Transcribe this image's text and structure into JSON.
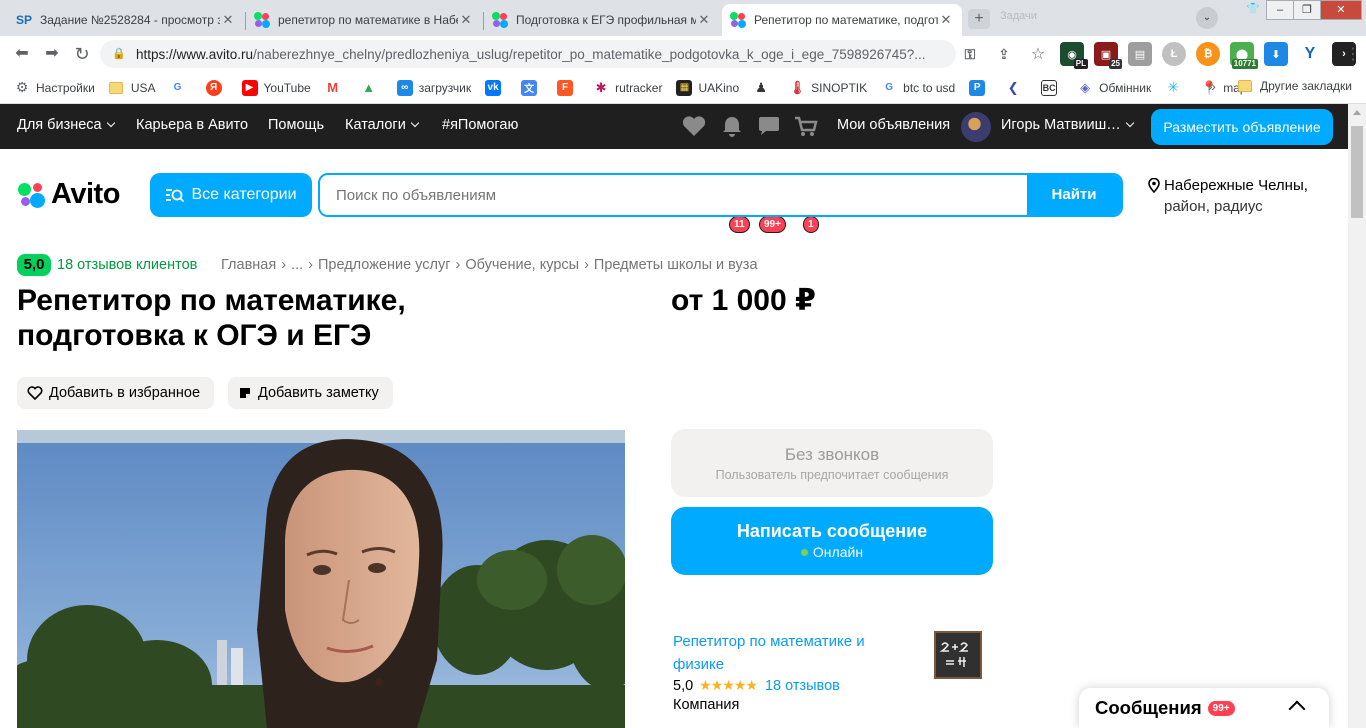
{
  "browser": {
    "tabs": [
      {
        "favicon": "SP",
        "title": "Задание №2528284 - просмотр за"
      },
      {
        "favicon": "avito-icon",
        "title": "репетитор по математике в Набе"
      },
      {
        "favicon": "avito-icon",
        "title": "Подготовка к ЕГЭ профильная ма"
      },
      {
        "favicon": "avito-icon",
        "title": "Репетитор по математике, подгот"
      }
    ],
    "ghost_tab": "Задачи",
    "url_host": "https://www.avito.ru",
    "url_path": "/naberezhnye_chelny/predlozheniya_uslug/repetitor_po_matematike_podgotovka_k_oge_i_ege_7598926745?...",
    "extensions": [
      {
        "name": "pl-extension-icon",
        "badge": "PL"
      },
      {
        "name": "counter-extension-icon",
        "badge": "25"
      },
      {
        "name": "gift-extension-icon",
        "badge": ""
      },
      {
        "name": "coin-extension-icon",
        "badge": ""
      },
      {
        "name": "bitcoin-extension-icon",
        "badge": ""
      },
      {
        "name": "price-extension-icon",
        "badge": "10771"
      },
      {
        "name": "download-extension-icon",
        "badge": ""
      },
      {
        "name": "v-extension-icon",
        "badge": ""
      },
      {
        "name": "terminal-extension-icon",
        "badge": ""
      },
      {
        "name": "puzzle-extension-icon",
        "badge": ""
      }
    ],
    "profile_initial": "I",
    "bookmarks": [
      {
        "icon": "gear-icon",
        "label": "Настройки"
      },
      {
        "icon": "folder-icon",
        "label": "USA"
      },
      {
        "icon": "google-icon",
        "label": ""
      },
      {
        "icon": "yandex-icon",
        "label": ""
      },
      {
        "icon": "youtube-icon",
        "label": "YouTube"
      },
      {
        "icon": "gmail-icon",
        "label": ""
      },
      {
        "icon": "drive-icon",
        "label": ""
      },
      {
        "icon": "infinity-icon",
        "label": "загрузчик"
      },
      {
        "icon": "vk-icon",
        "label": ""
      },
      {
        "icon": "translate-icon",
        "label": ""
      },
      {
        "icon": "f-icon",
        "label": ""
      },
      {
        "icon": "rutracker-icon",
        "label": "rutracker"
      },
      {
        "icon": "uakino-icon",
        "label": "UAKino"
      },
      {
        "icon": "chess-icon",
        "label": ""
      },
      {
        "icon": "thermometer-icon",
        "label": "SINOPTIK"
      },
      {
        "icon": "google-icon",
        "label": "btc to usd"
      },
      {
        "icon": "p-icon",
        "label": ""
      },
      {
        "icon": "arrow-icon",
        "label": ""
      },
      {
        "icon": "bc-icon",
        "label": ""
      },
      {
        "icon": "diamond-icon",
        "label": "Обмінник"
      },
      {
        "icon": "snowflake-icon",
        "label": ""
      },
      {
        "icon": "maps-icon",
        "label": "maps"
      }
    ],
    "other_bookmarks": "Другие закладки"
  },
  "nav": {
    "business": "Для бизнеса",
    "career": "Карьера в Авито",
    "help": "Помощь",
    "catalogs": "Каталоги",
    "i_help": "#яПомогаю",
    "notifications_badge": "11",
    "messages_badge": "99+",
    "cart_badge": "1",
    "my_ads": "Мои объявления",
    "user": "Игорь Матвииш…",
    "post_ad": "Разместить объявление"
  },
  "header": {
    "logo": "Avito",
    "categories": "Все категории",
    "search_placeholder": "Поиск по объявлениям",
    "search_button": "Найти",
    "location_city": "Набережные Челны,",
    "location_area": "район, радиус"
  },
  "listing": {
    "rating": "5,0",
    "reviews": "18 отзывов клиентов",
    "breadcrumbs": [
      "Главная",
      "›",
      "...",
      "›",
      "Предложение услуг",
      "›",
      "Обучение, курсы",
      "›",
      "Предметы школы и вуза"
    ],
    "title": "Репетитор по математике, подготовка к ОГЭ и ЕГЭ",
    "price": "от 1 000 ₽",
    "add_favorite": "Добавить в избранное",
    "add_note": "Добавить заметку"
  },
  "contact": {
    "no_calls": "Без звонков",
    "no_calls_hint": "Пользователь предпочитает сообщения",
    "write_message": "Написать сообщение",
    "online": "Онлайн"
  },
  "seller": {
    "name": "Репетитор по математике и физике",
    "rating": "5,0",
    "stars": "★★★★★",
    "reviews": "18 отзывов",
    "type": "Компания"
  },
  "messenger": {
    "title": "Сообщения",
    "badge": "99+"
  },
  "colors": {
    "accent": "#00aaff",
    "nav_bg": "#1f1f1f",
    "rating_green": "#02d15c",
    "badge_red": "#ff4053"
  }
}
